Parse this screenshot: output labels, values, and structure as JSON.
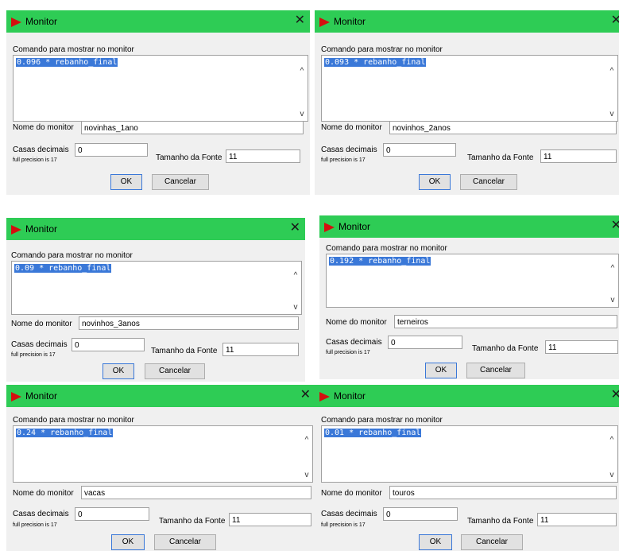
{
  "common": {
    "title": "Monitor",
    "command_label": "Comando para mostrar no monitor",
    "name_label": "Nome do monitor",
    "decimals_label": "Casas decimais",
    "font_size_label": "Tamanho da Fonte",
    "precision_note": "full precision is 17",
    "ok_label": "OK",
    "cancel_label": "Cancelar",
    "close_glyph": "✕",
    "scroll_up_glyph": "^",
    "scroll_down_glyph": "v"
  },
  "dialogs": [
    {
      "command": "0.096 * rebanho_final",
      "name": "novinhas_1ano",
      "decimals": "0",
      "font_size": "11"
    },
    {
      "command": "0.093 * rebanho_final",
      "name": "novinhos_2anos",
      "decimals": "0",
      "font_size": "11"
    },
    {
      "command": "0.09 * rebanho_final",
      "name": "novinhos_3anos",
      "decimals": "0",
      "font_size": "11"
    },
    {
      "command": "0.192 * rebanho_final",
      "name": "terneiros",
      "decimals": "0",
      "font_size": "11"
    },
    {
      "command": "0.24 * rebanho_final",
      "name": "vacas",
      "decimals": "0",
      "font_size": "11"
    },
    {
      "command": "0.01 * rebanho_final",
      "name": "touros",
      "decimals": "0",
      "font_size": "11"
    }
  ],
  "colors": {
    "title_bar": "#2ecc55",
    "arrow": "#d40f0f",
    "selection": "#3a78d8"
  }
}
